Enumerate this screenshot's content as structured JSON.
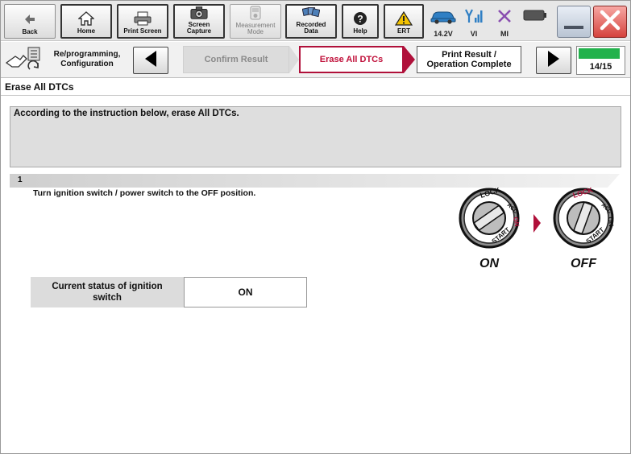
{
  "toolbar": {
    "back": "Back",
    "home": "Home",
    "print_screen": "Print Screen",
    "screen_capture": "Screen\nCapture",
    "measurement_mode": "Measurement\nMode",
    "recorded_data": "Recorded\nData",
    "help": "Help",
    "ert": "ERT",
    "voltage": "14.2V",
    "vi": "VI",
    "mi": "MI"
  },
  "stepbar": {
    "crumb": "Re/programming,\nConfiguration",
    "steps": [
      "Confirm Result",
      "Erase All DTCs",
      "Print Result /\nOperation Complete"
    ],
    "page": "14/15",
    "progress_fraction": 0.93
  },
  "main": {
    "title": "Erase All DTCs",
    "instruction": "According to the instruction below, erase All DTCs.",
    "step_number": "1",
    "step_text": "Turn ignition switch / power switch to the OFF position.",
    "ignition": {
      "key_labels": [
        "LOCK",
        "ACC",
        "ON",
        "START"
      ],
      "state_on": "ON",
      "state_off": "OFF"
    },
    "status_label": "Current status of ignition\nswitch",
    "status_value": "ON"
  },
  "colors": {
    "accent_red": "#b0103a",
    "progress_green": "#22b24c"
  }
}
